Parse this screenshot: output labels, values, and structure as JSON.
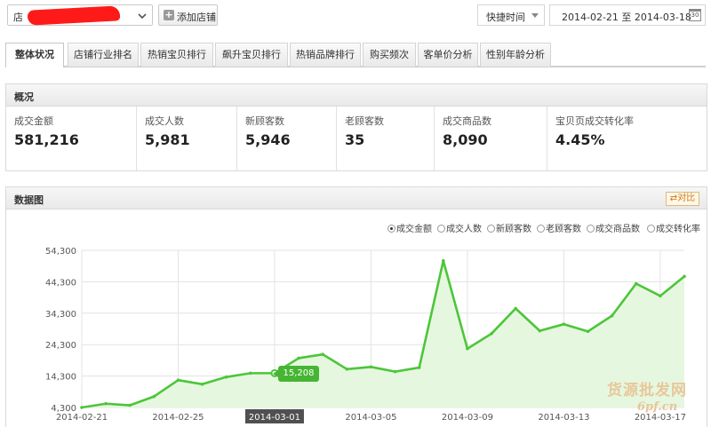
{
  "topbar": {
    "shop_select_label": "店",
    "add_shop_label": "添加店铺",
    "quick_time_label": "快捷时间",
    "date_range": "2014-02-21 至 2014-03-18",
    "calendar_label": "30"
  },
  "tabs": [
    "整体状况",
    "店铺行业排名",
    "热销宝贝排行",
    "飙升宝贝排行",
    "热销品牌排行",
    "购买频次",
    "客单价分析",
    "性别年龄分析"
  ],
  "overview": {
    "title": "概况",
    "metrics": [
      {
        "label": "成交金额",
        "value": "581,216"
      },
      {
        "label": "成交人数",
        "value": "5,981"
      },
      {
        "label": "新顾客数",
        "value": "5,946"
      },
      {
        "label": "老顾客数",
        "value": "35"
      },
      {
        "label": "成交商品数",
        "value": "8,090"
      },
      {
        "label": "宝贝页成交转化率",
        "value": "4.45%"
      }
    ]
  },
  "chart_panel": {
    "title": "数据图",
    "compare_label": "对比",
    "legend": [
      "成交金额",
      "成交人数",
      "新顾客数",
      "老顾客数",
      "成交商品数",
      "成交转化率"
    ],
    "selected_legend": "成交金额",
    "tooltip": "15,208"
  },
  "watermark": {
    "line1": "货源批发网",
    "line2": "6pf.cn"
  },
  "chart_data": {
    "type": "area",
    "title": "",
    "xlabel": "",
    "ylabel": "",
    "series": [
      {
        "name": "成交金额",
        "color": "#4cc63a",
        "values": [
          4300,
          5500,
          5000,
          7800,
          13000,
          11700,
          14000,
          15208,
          15208,
          20000,
          21200,
          16500,
          17200,
          15700,
          17000,
          51000,
          23000,
          27800,
          35800,
          28700,
          30800,
          28500,
          33500,
          43700,
          39800,
          46000
        ]
      }
    ],
    "x": [
      "2014-02-21",
      "2014-02-22",
      "2014-02-23",
      "2014-02-24",
      "2014-02-25",
      "2014-02-26",
      "2014-02-27",
      "2014-02-28",
      "2014-03-01",
      "2014-03-02",
      "2014-03-03",
      "2014-03-04",
      "2014-03-05",
      "2014-03-06",
      "2014-03-07",
      "2014-03-08",
      "2014-03-09",
      "2014-03-10",
      "2014-03-11",
      "2014-03-12",
      "2014-03-13",
      "2014-03-14",
      "2014-03-15",
      "2014-03-16",
      "2014-03-17",
      "2014-03-18"
    ],
    "x_ticks": [
      "2014-02-21",
      "2014-02-25",
      "2014-03-01",
      "2014-03-05",
      "2014-03-09",
      "2014-03-13",
      "2014-03-17"
    ],
    "highlight_tick": "2014-03-01",
    "y_ticks": [
      4300,
      14300,
      24300,
      34300,
      44300,
      54300
    ],
    "y_tick_labels": [
      "4,300",
      "14,300",
      "24,300",
      "34,300",
      "44,300",
      "54,300"
    ],
    "ylim": [
      4300,
      54300
    ],
    "grid": true,
    "highlight_index": 8,
    "fill_color": "#e6f7df",
    "line_color": "#4cc63a"
  }
}
